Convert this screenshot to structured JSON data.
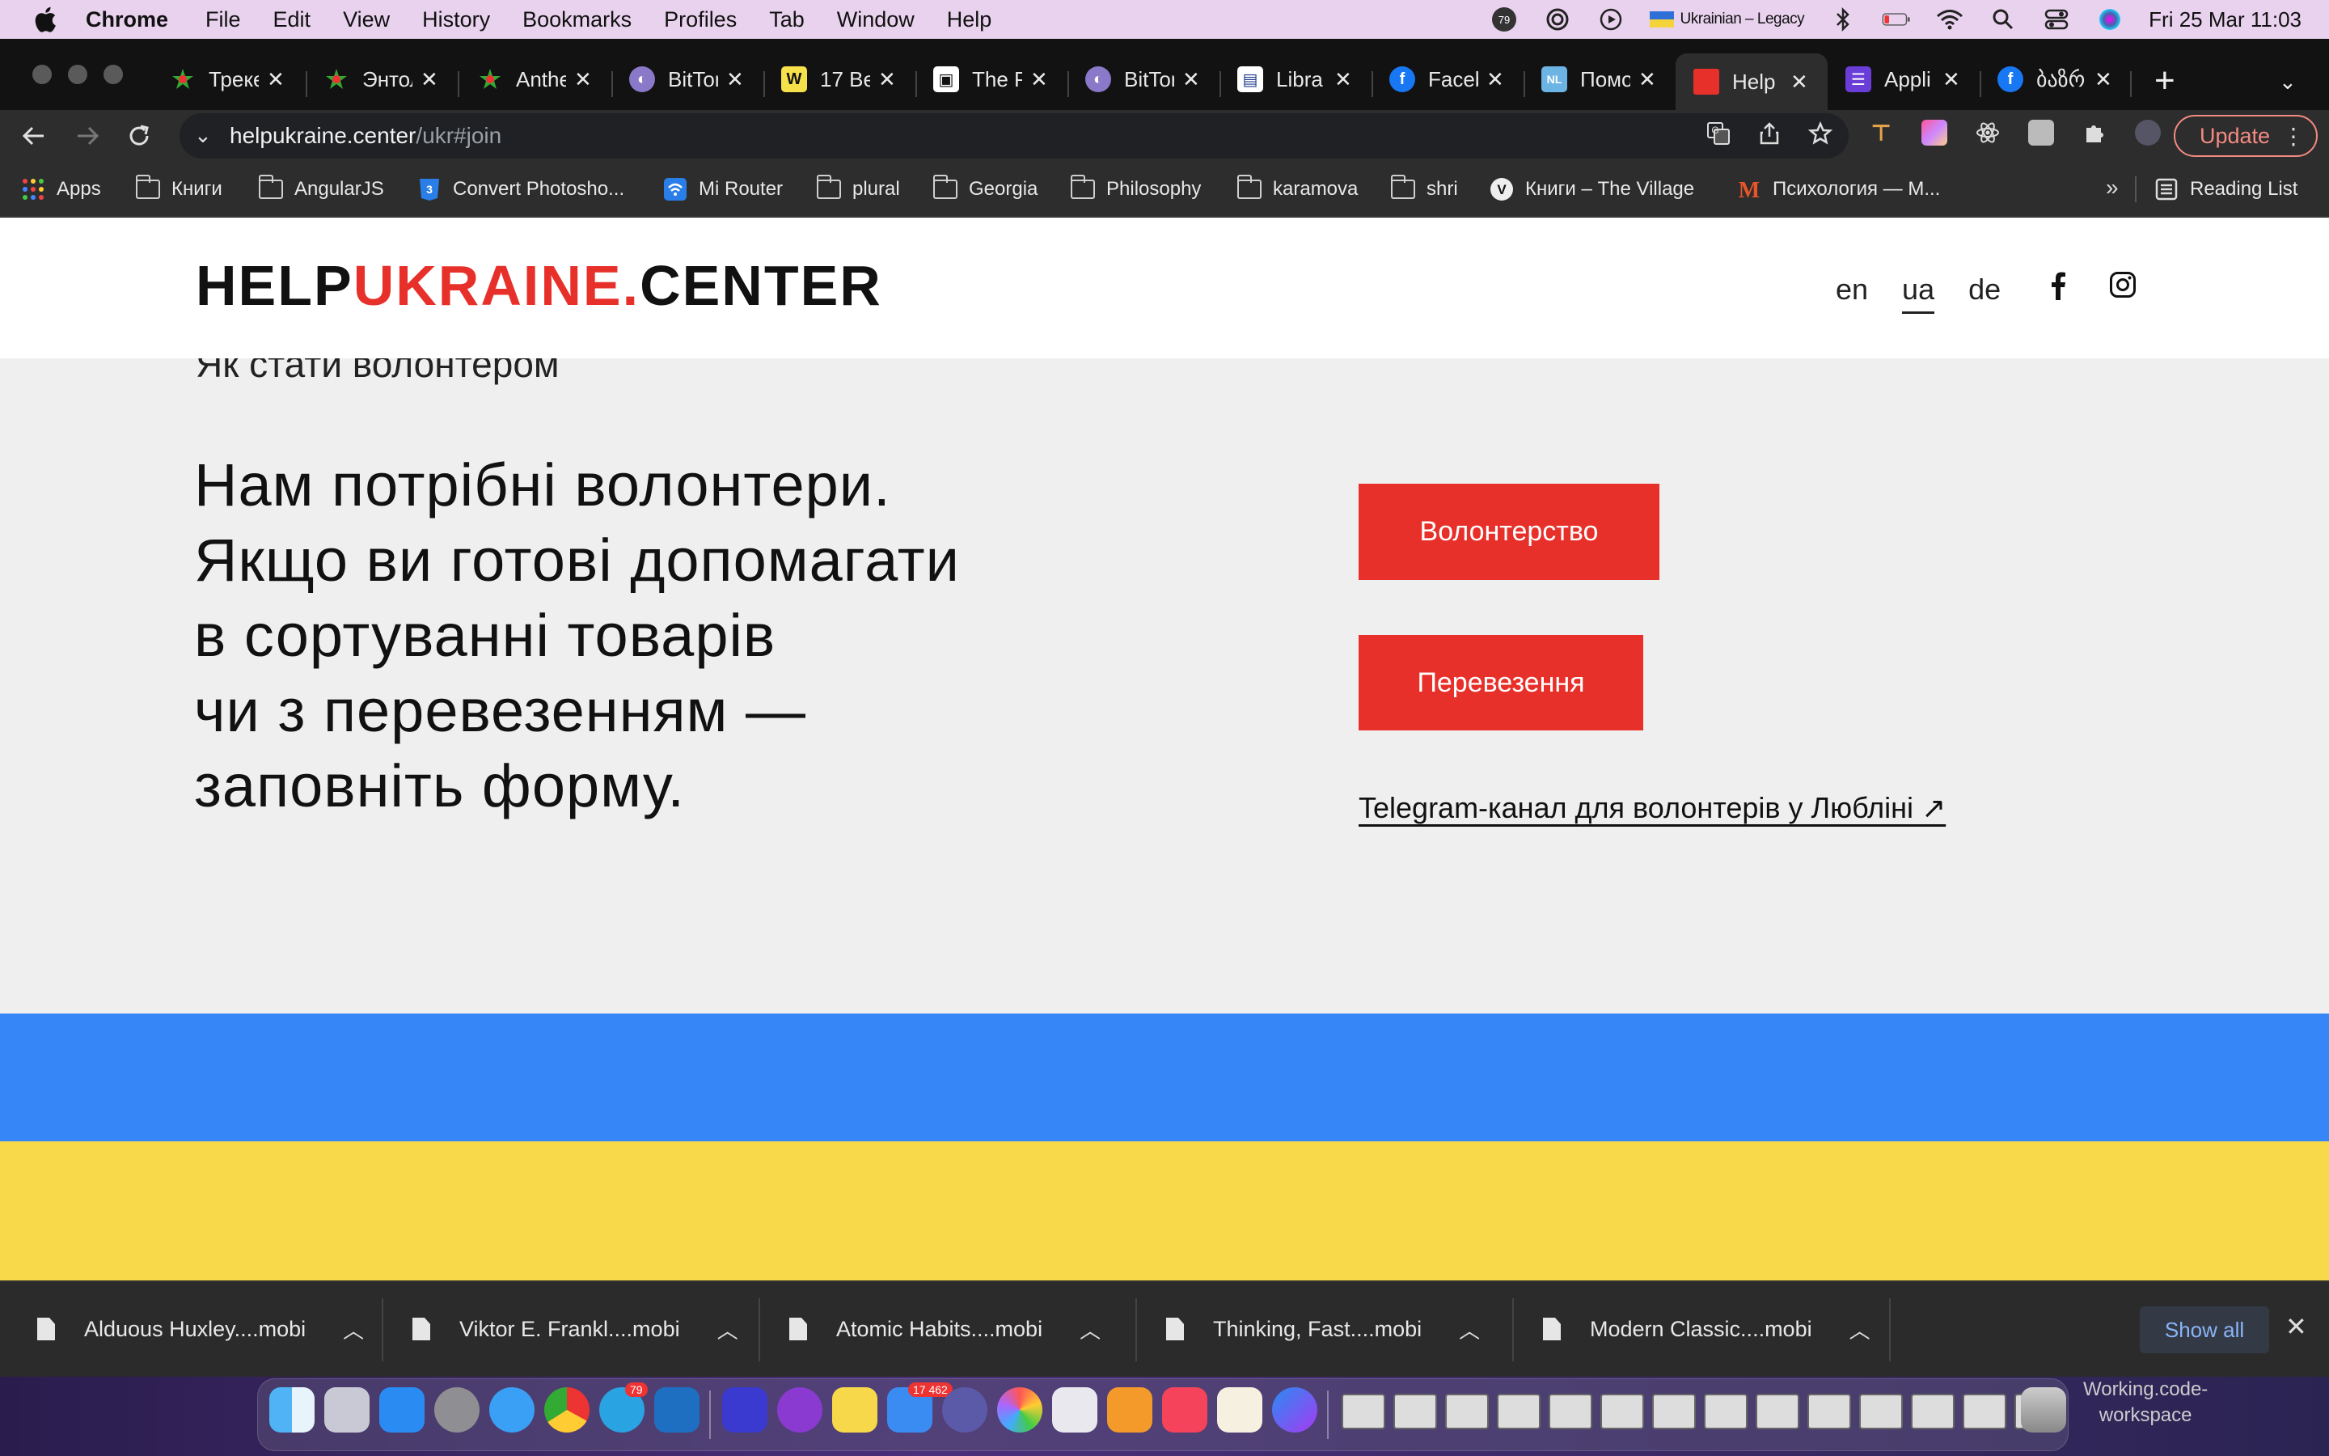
{
  "menubar": {
    "app_name": "Chrome",
    "items": [
      "File",
      "Edit",
      "View",
      "History",
      "Bookmarks",
      "Profiles",
      "Tab",
      "Window",
      "Help"
    ],
    "badge_count": "79",
    "keyboard_layout": "Ukrainian – Legacy",
    "datetime": "Fri 25 Mar  11:03"
  },
  "tabs": [
    {
      "title": "Трекер"
    },
    {
      "title": "Энтол"
    },
    {
      "title": "Anthe"
    },
    {
      "title": "BitTor"
    },
    {
      "title": "17 Be"
    },
    {
      "title": "The P"
    },
    {
      "title": "BitTor"
    },
    {
      "title": "Libra"
    },
    {
      "title": "Faceb"
    },
    {
      "title": "Помо"
    },
    {
      "title": "Help",
      "active": true
    },
    {
      "title": "Appli"
    },
    {
      "title": "ბაზრ"
    }
  ],
  "toolbar": {
    "url_host": "helpukraine.center",
    "url_path": "/ukr#join",
    "update_label": "Update"
  },
  "bookmarks": [
    {
      "label": "Apps",
      "icon": "apps-grid-icon"
    },
    {
      "label": "Книги",
      "icon": "folder-icon"
    },
    {
      "label": "AngularJS",
      "icon": "folder-icon"
    },
    {
      "label": "Convert Photosho...",
      "icon": "css3-icon"
    },
    {
      "label": "Mi Router",
      "icon": "wifi-router-icon"
    },
    {
      "label": "plural",
      "icon": "folder-icon"
    },
    {
      "label": "Georgia",
      "icon": "folder-icon"
    },
    {
      "label": "Philosophy",
      "icon": "folder-icon"
    },
    {
      "label": "karamova",
      "icon": "folder-icon"
    },
    {
      "label": "shri",
      "icon": "folder-icon"
    },
    {
      "label": "Книги – The Village",
      "icon": "village-icon"
    },
    {
      "label": "Психология — М...",
      "icon": "m-logo-icon"
    }
  ],
  "reading_list": "Reading List",
  "site": {
    "logo": {
      "part1": "HELP",
      "part2": "UKRAINE.",
      "part3": "CENTER"
    },
    "languages": [
      "en",
      "ua",
      "de"
    ],
    "active_language": "ua",
    "section_subtitle": "Як стати волонтером",
    "lead_lines": [
      "Нам потрібні волонтери.",
      "Якщо ви готові допомагати",
      "в сортуванні товарів",
      "чи з перевезенням —",
      "заповніть форму."
    ],
    "buttons": {
      "volunteering": "Волонтерство",
      "transport": "Перевезення"
    },
    "telegram_link": "Telegram-канал для волонтерів у Любліні ↗",
    "colors": {
      "accent": "#e8302a",
      "flag_blue": "#3686f7",
      "flag_yellow": "#f8d94a"
    }
  },
  "downloads": [
    {
      "name": "Alduous Huxley....mobi"
    },
    {
      "name": "Viktor E. Frankl....mobi"
    },
    {
      "name": "Atomic Habits....mobi"
    },
    {
      "name": "Thinking, Fast....mobi"
    },
    {
      "name": "Modern Classic....mobi"
    }
  ],
  "downloads_show_all": "Show all",
  "dock": {
    "mail_badge": "17 462",
    "telegram_badge": "79",
    "workspace_label_1": "Working.code-",
    "workspace_label_2": "workspace"
  }
}
